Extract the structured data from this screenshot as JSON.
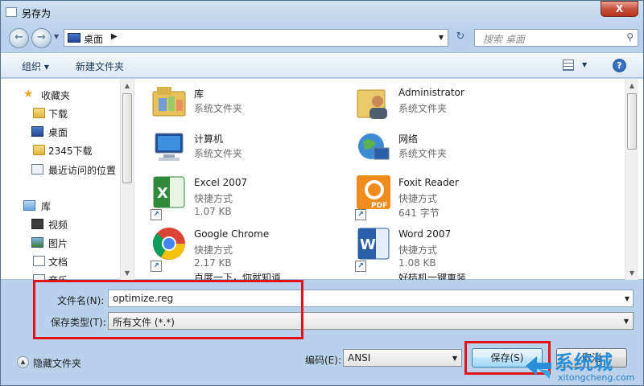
{
  "window": {
    "title": "另存为",
    "close_label": "X"
  },
  "nav": {
    "back_icon": "back-arrow-icon",
    "forward_icon": "forward-arrow-icon",
    "address": "桌面",
    "refresh_icon": "refresh-icon",
    "search_placeholder": "搜索 桌面"
  },
  "toolbar": {
    "organize": "组织 ▾",
    "new_folder": "新建文件夹",
    "help": "?"
  },
  "sidebar": {
    "items": [
      {
        "label": "收藏夹",
        "icon": "star-icon"
      },
      {
        "label": "下载",
        "icon": "folder-icon"
      },
      {
        "label": "桌面",
        "icon": "desktop-icon"
      },
      {
        "label": "2345下载",
        "icon": "folder-icon"
      },
      {
        "label": "最近访问的位置",
        "icon": "recent-places-icon"
      },
      {
        "label": "库",
        "icon": "library-icon"
      },
      {
        "label": "视频",
        "icon": "video-icon"
      },
      {
        "label": "图片",
        "icon": "pictures-icon"
      },
      {
        "label": "文档",
        "icon": "documents-icon"
      },
      {
        "label": "音乐",
        "icon": "music-icon"
      }
    ]
  },
  "files": [
    {
      "name": "库",
      "type": "系统文件夹",
      "size": ""
    },
    {
      "name": "Administrator",
      "type": "系统文件夹",
      "size": ""
    },
    {
      "name": "计算机",
      "type": "系统文件夹",
      "size": ""
    },
    {
      "name": "网络",
      "type": "系统文件夹",
      "size": ""
    },
    {
      "name": "Excel 2007",
      "type": "快捷方式",
      "size": "1.07 KB"
    },
    {
      "name": "Foxit Reader",
      "type": "快捷方式",
      "size": "641 字节"
    },
    {
      "name": "Google Chrome",
      "type": "快捷方式",
      "size": "2.17 KB"
    },
    {
      "name": "Word 2007",
      "type": "快捷方式",
      "size": "1.08 KB"
    },
    {
      "name": "百度一下，你就知道",
      "type": "",
      "size": ""
    },
    {
      "name": "好桔机一键重装",
      "type": "",
      "size": ""
    }
  ],
  "form": {
    "filename_label": "文件名(N):",
    "filename_value": "optimize.reg",
    "filetype_label": "保存类型(T):",
    "filetype_value": "所有文件 (*.*)",
    "encoding_label": "编码(E):",
    "encoding_value": "ANSI",
    "hide_folders": "隐藏文件夹",
    "save": "保存(S)",
    "cancel": "取消"
  },
  "watermark": {
    "brand": "系统城",
    "url": "xitongcheng.com"
  },
  "colors": {
    "highlight": "#e3121a",
    "accent": "#2a8fd8"
  }
}
